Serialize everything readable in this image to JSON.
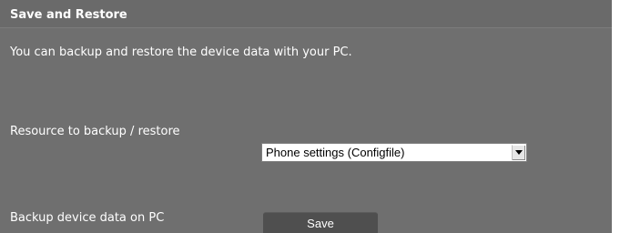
{
  "section": {
    "title": "Save and Restore",
    "description": "You can backup and restore the device data with your PC."
  },
  "resource": {
    "label": "Resource to backup / restore",
    "selected_value": "Phone settings (Configfile)"
  },
  "backup": {
    "label": "Backup device data on PC",
    "button_label": "Save"
  }
}
